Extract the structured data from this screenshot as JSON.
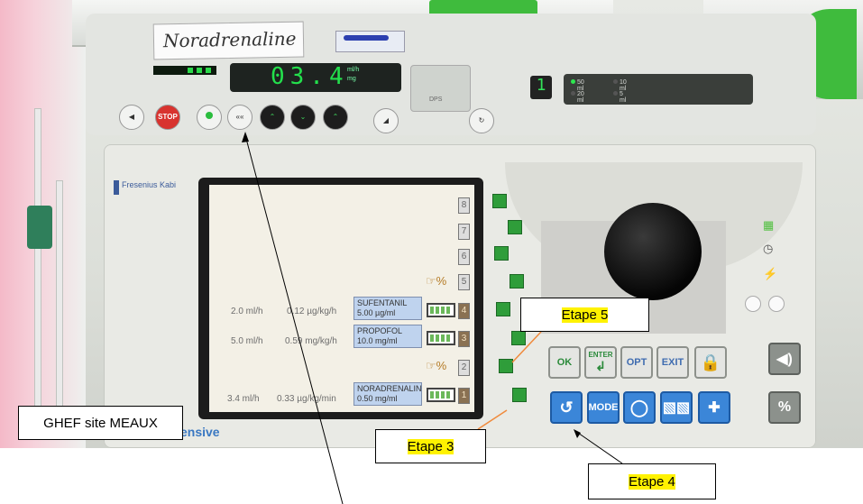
{
  "syringe_label": "Noradrenaline",
  "pump_display": {
    "rate": "03.4",
    "unit_top": "ml/h",
    "unit_bottom": "mg",
    "channel": "1"
  },
  "volume_panel": {
    "v1": "50 ml",
    "v2": "10 ml",
    "v3": "20 ml",
    "v4": "5 ml"
  },
  "panel_brand": "Fresenius Kabi",
  "brand_small": "DPS",
  "stop_label": "STOP",
  "footer_brand": "ensive",
  "screen": {
    "slots": [
      "8",
      "7",
      "6",
      "5",
      "4",
      "3",
      "2",
      "1"
    ],
    "rows": [
      {
        "rate": "2.0 ml/h",
        "dose": "0.12 µg/kg/h",
        "drug": "SUFENTANIL",
        "conc": "5.00 µg/ml"
      },
      {
        "rate": "5.0 ml/h",
        "dose": "0.59 mg/kg/h",
        "drug": "PROPOFOL",
        "conc": "10.0 mg/ml"
      },
      {
        "rate": "3.4 ml/h",
        "dose": "0.33 µg/kg/min",
        "drug": "NORADRENALIN",
        "conc": "0.50 mg/ml"
      }
    ],
    "percent_symbol": "%"
  },
  "keypad": {
    "ok": "OK",
    "enter": "ENTER",
    "opt": "OPT",
    "exit": "EXIT",
    "mode": "MODE",
    "lock_icon": "lock-icon",
    "mute_icon": "speaker-mute-icon",
    "percent": "%"
  },
  "annotations": {
    "site": "GHEF site MEAUX",
    "step5": "Etape 5",
    "step3": "Etape 3",
    "step4": "Etape 4"
  },
  "colors": {
    "highlight": "#fff200",
    "arrow": "#f08a3c",
    "pump_green": "#3fbb3d",
    "key_blue": "#3b86d8"
  }
}
